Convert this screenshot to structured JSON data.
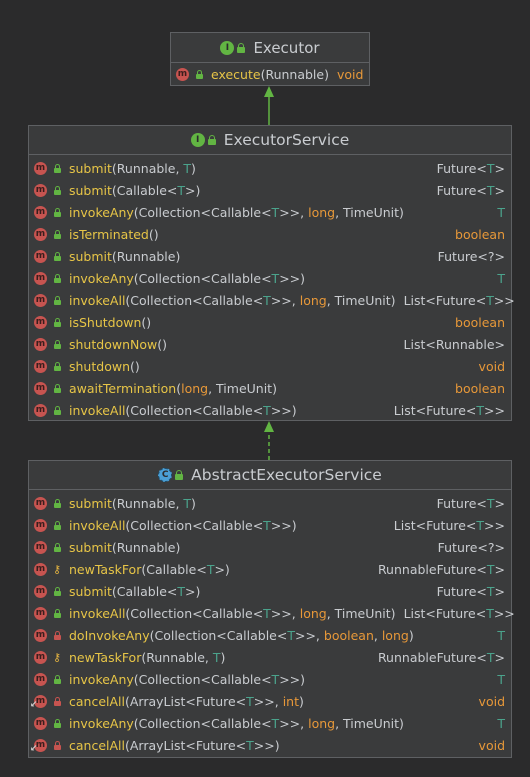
{
  "executor": {
    "title": "Executor",
    "methods": [
      {
        "name": "execute",
        "sig": [
          [
            "(Runnable) ",
            ""
          ]
        ],
        "ret": [
          [
            "void",
            "p"
          ]
        ],
        "vis": "public"
      }
    ]
  },
  "executor_service": {
    "title": "ExecutorService",
    "methods": [
      {
        "name": "submit",
        "sig": [
          [
            "(Runnable, ",
            ""
          ],
          [
            "T",
            "t"
          ],
          [
            ")",
            ""
          ]
        ],
        "ret": [
          [
            "Future<",
            ""
          ],
          [
            "T",
            "t"
          ],
          [
            ">",
            ""
          ]
        ],
        "vis": "public"
      },
      {
        "name": "submit",
        "sig": [
          [
            "(Callable<",
            ""
          ],
          [
            "T",
            "t"
          ],
          [
            ">)",
            ""
          ]
        ],
        "ret": [
          [
            "Future<",
            ""
          ],
          [
            "T",
            "t"
          ],
          [
            ">",
            ""
          ]
        ],
        "vis": "public"
      },
      {
        "name": "invokeAny",
        "sig": [
          [
            "(Collection<Callable<",
            ""
          ],
          [
            "T",
            "t"
          ],
          [
            ">>, ",
            ""
          ],
          [
            "long",
            "p"
          ],
          [
            ", TimeUnit)",
            ""
          ]
        ],
        "ret": [
          [
            "T",
            "t"
          ]
        ],
        "vis": "public"
      },
      {
        "name": "isTerminated",
        "sig": [
          [
            "()",
            ""
          ]
        ],
        "ret": [
          [
            "boolean",
            "p"
          ]
        ],
        "vis": "public"
      },
      {
        "name": "submit",
        "sig": [
          [
            "(Runnable)",
            ""
          ]
        ],
        "ret": [
          [
            "Future<?>",
            ""
          ]
        ],
        "vis": "public"
      },
      {
        "name": "invokeAny",
        "sig": [
          [
            "(Collection<Callable<",
            ""
          ],
          [
            "T",
            "t"
          ],
          [
            ">>)",
            ""
          ]
        ],
        "ret": [
          [
            "T",
            "t"
          ]
        ],
        "vis": "public"
      },
      {
        "name": "invokeAll",
        "sig": [
          [
            "(Collection<Callable<",
            ""
          ],
          [
            "T",
            "t"
          ],
          [
            ">>, ",
            ""
          ],
          [
            "long",
            "p"
          ],
          [
            ", TimeUnit)",
            ""
          ]
        ],
        "ret": [
          [
            "List<Future<",
            ""
          ],
          [
            "T",
            "t"
          ],
          [
            ">>",
            ""
          ]
        ],
        "vis": "public"
      },
      {
        "name": "isShutdown",
        "sig": [
          [
            "()",
            ""
          ]
        ],
        "ret": [
          [
            "boolean",
            "p"
          ]
        ],
        "vis": "public"
      },
      {
        "name": "shutdownNow",
        "sig": [
          [
            "()",
            ""
          ]
        ],
        "ret": [
          [
            "List<Runnable>",
            ""
          ]
        ],
        "vis": "public"
      },
      {
        "name": "shutdown",
        "sig": [
          [
            "()",
            ""
          ]
        ],
        "ret": [
          [
            "void",
            "p"
          ]
        ],
        "vis": "public"
      },
      {
        "name": "awaitTermination",
        "sig": [
          [
            "(",
            ""
          ],
          [
            "long",
            "p"
          ],
          [
            ", TimeUnit)",
            ""
          ]
        ],
        "ret": [
          [
            "boolean",
            "p"
          ]
        ],
        "vis": "public"
      },
      {
        "name": "invokeAll",
        "sig": [
          [
            "(Collection<Callable<",
            ""
          ],
          [
            "T",
            "t"
          ],
          [
            ">>)",
            ""
          ]
        ],
        "ret": [
          [
            "List<Future<",
            ""
          ],
          [
            "T",
            "t"
          ],
          [
            ">>",
            ""
          ]
        ],
        "vis": "public"
      }
    ]
  },
  "abstract_executor_service": {
    "title": "AbstractExecutorService",
    "methods": [
      {
        "name": "submit",
        "sig": [
          [
            "(Runnable, ",
            ""
          ],
          [
            "T",
            "t"
          ],
          [
            ")",
            ""
          ]
        ],
        "ret": [
          [
            "Future<",
            ""
          ],
          [
            "T",
            "t"
          ],
          [
            ">",
            ""
          ]
        ],
        "vis": "public"
      },
      {
        "name": "invokeAll",
        "sig": [
          [
            "(Collection<Callable<",
            ""
          ],
          [
            "T",
            "t"
          ],
          [
            ">>)",
            ""
          ]
        ],
        "ret": [
          [
            "List<Future<",
            ""
          ],
          [
            "T",
            "t"
          ],
          [
            ">>",
            ""
          ]
        ],
        "vis": "public"
      },
      {
        "name": "submit",
        "sig": [
          [
            "(Runnable)",
            ""
          ]
        ],
        "ret": [
          [
            "Future<?>",
            ""
          ]
        ],
        "vis": "public"
      },
      {
        "name": "newTaskFor",
        "sig": [
          [
            "(Callable<",
            ""
          ],
          [
            "T",
            "t"
          ],
          [
            ">)",
            ""
          ]
        ],
        "ret": [
          [
            "RunnableFuture<",
            ""
          ],
          [
            "T",
            "t"
          ],
          [
            ">",
            ""
          ]
        ],
        "vis": "protected"
      },
      {
        "name": "submit",
        "sig": [
          [
            "(Callable<",
            ""
          ],
          [
            "T",
            "t"
          ],
          [
            ">)",
            ""
          ]
        ],
        "ret": [
          [
            "Future<",
            ""
          ],
          [
            "T",
            "t"
          ],
          [
            ">",
            ""
          ]
        ],
        "vis": "public"
      },
      {
        "name": "invokeAll",
        "sig": [
          [
            "(Collection<Callable<",
            ""
          ],
          [
            "T",
            "t"
          ],
          [
            ">>, ",
            ""
          ],
          [
            "long",
            "p"
          ],
          [
            ", TimeUnit)",
            ""
          ]
        ],
        "ret": [
          [
            "List<Future<",
            ""
          ],
          [
            "T",
            "t"
          ],
          [
            ">>",
            ""
          ]
        ],
        "vis": "public"
      },
      {
        "name": "doInvokeAny",
        "sig": [
          [
            "(Collection<Callable<",
            ""
          ],
          [
            "T",
            "t"
          ],
          [
            ">>, ",
            ""
          ],
          [
            "boolean",
            "p"
          ],
          [
            ", ",
            ""
          ],
          [
            "long",
            "p"
          ],
          [
            ")",
            ""
          ]
        ],
        "ret": [
          [
            "T",
            "t"
          ]
        ],
        "vis": "private"
      },
      {
        "name": "newTaskFor",
        "sig": [
          [
            "(Runnable, ",
            ""
          ],
          [
            "T",
            "t"
          ],
          [
            ")",
            ""
          ]
        ],
        "ret": [
          [
            "RunnableFuture<",
            ""
          ],
          [
            "T",
            "t"
          ],
          [
            ">",
            ""
          ]
        ],
        "vis": "protected"
      },
      {
        "name": "invokeAny",
        "sig": [
          [
            "(Collection<Callable<",
            ""
          ],
          [
            "T",
            "t"
          ],
          [
            ">>)",
            ""
          ]
        ],
        "ret": [
          [
            "T",
            "t"
          ]
        ],
        "vis": "public"
      },
      {
        "name": "cancelAll",
        "sig": [
          [
            "(ArrayList<Future<",
            ""
          ],
          [
            "T",
            "t"
          ],
          [
            ">>, ",
            ""
          ],
          [
            "int",
            "p"
          ],
          [
            ")",
            ""
          ]
        ],
        "ret": [
          [
            "void",
            "p"
          ]
        ],
        "vis": "private",
        "override": true
      },
      {
        "name": "invokeAny",
        "sig": [
          [
            "(Collection<Callable<",
            ""
          ],
          [
            "T",
            "t"
          ],
          [
            ">>, ",
            ""
          ],
          [
            "long",
            "p"
          ],
          [
            ", TimeUnit)",
            ""
          ]
        ],
        "ret": [
          [
            "T",
            "t"
          ]
        ],
        "vis": "public"
      },
      {
        "name": "cancelAll",
        "sig": [
          [
            "(ArrayList<Future<",
            ""
          ],
          [
            "T",
            "t"
          ],
          [
            ">>)",
            ""
          ]
        ],
        "ret": [
          [
            "void",
            "p"
          ]
        ],
        "vis": "private",
        "override": true
      }
    ]
  },
  "colors": {
    "background": "#2b2b2c",
    "box": "#3a3b3c",
    "border": "#5e6063",
    "text": "#c9ccd0",
    "method_name": "#e7c547",
    "type_param": "#4ba38c",
    "primitive": "#e79839",
    "arrow": "#62b543",
    "method_icon": "#c75450"
  },
  "icons": {
    "interface": "interface-icon",
    "abstract_class": "abstract-class-icon",
    "method": "method-icon",
    "public": "public-lock-icon",
    "private": "private-lock-icon",
    "protected": "protected-key-icon"
  }
}
